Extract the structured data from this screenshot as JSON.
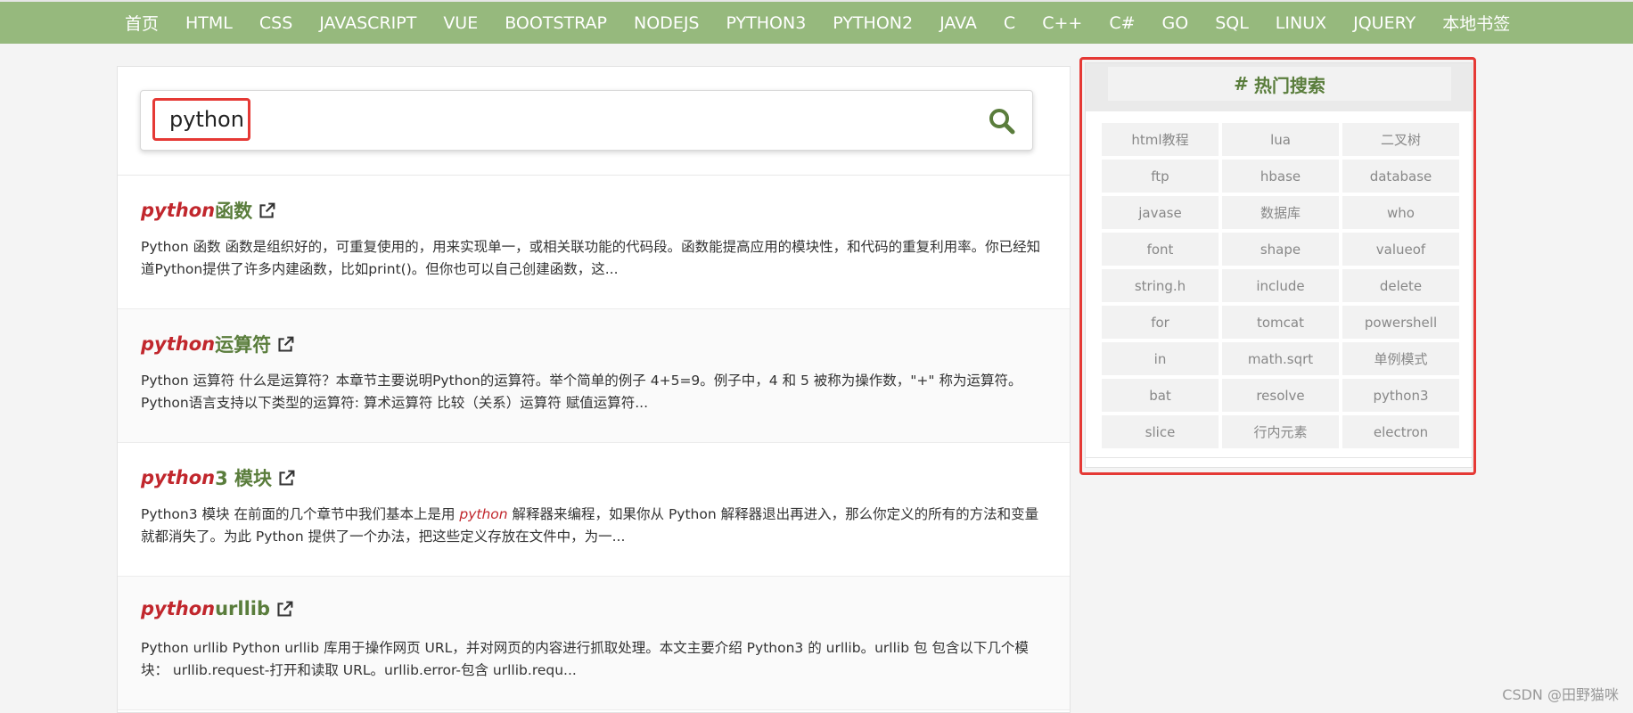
{
  "nav": {
    "items": [
      "首页",
      "HTML",
      "CSS",
      "JAVASCRIPT",
      "VUE",
      "BOOTSTRAP",
      "NODEJS",
      "PYTHON3",
      "PYTHON2",
      "JAVA",
      "C",
      "C++",
      "C#",
      "GO",
      "SQL",
      "LINUX",
      "JQUERY",
      "本地书签"
    ]
  },
  "search": {
    "value": "python",
    "icon": "search-icon"
  },
  "results": [
    {
      "kw": "python",
      "rest": " 函数",
      "snippet": "Python 函数 函数是组织好的，可重复使用的，用来实现单一，或相关联功能的代码段。函数能提高应用的模块性，和代码的重复利用率。你已经知道Python提供了许多内建函数，比如print()。但你也可以自己创建函数，这..."
    },
    {
      "kw": "python",
      "rest": " 运算符",
      "snippet": "Python 运算符 什么是运算符？本章节主要说明Python的运算符。举个简单的例子 4+5=9。例子中，4 和 5 被称为操作数，\"+\" 称为运算符。Python语言支持以下类型的运算符: 算术运算符 比较（关系）运算符 赋值运算符..."
    },
    {
      "kw": "python",
      "rest": "3 模块",
      "snippet_before": "Python3 模块 在前面的几个章节中我们基本上是用 ",
      "snippet_em": "python",
      "snippet_after": " 解释器来编程，如果你从 Python 解释器退出再进入，那么你定义的所有的方法和变量就都消失了。为此 Python 提供了一个办法，把这些定义存放在文件中，为一..."
    },
    {
      "kw": "python",
      "rest": " urllib",
      "snippet": "Python urllib Python urllib 库用于操作网页 URL，并对网页的内容进行抓取处理。本文主要介绍 Python3 的 urllib。urllib 包 包含以下几个模块： urllib.request-打开和读取 URL。urllib.error-包含 urllib.requ..."
    }
  ],
  "hot": {
    "hash": "#",
    "title": "热门搜索",
    "tags": [
      "html教程",
      "lua",
      "二叉树",
      "ftp",
      "hbase",
      "database",
      "javase",
      "数据库",
      "who",
      "font",
      "shape",
      "valueof",
      "string.h",
      "include",
      "delete",
      "for",
      "tomcat",
      "powershell",
      "in",
      "math.sqrt",
      "单例模式",
      "bat",
      "resolve",
      "python3",
      "slice",
      "行内元素",
      "electron"
    ]
  },
  "watermark": "CSDN @田野猫咪",
  "colors": {
    "nav_bg": "#96b97d",
    "keyword": "#c1272d",
    "title_green": "#5a7d3c",
    "highlight_box": "#e53935"
  }
}
